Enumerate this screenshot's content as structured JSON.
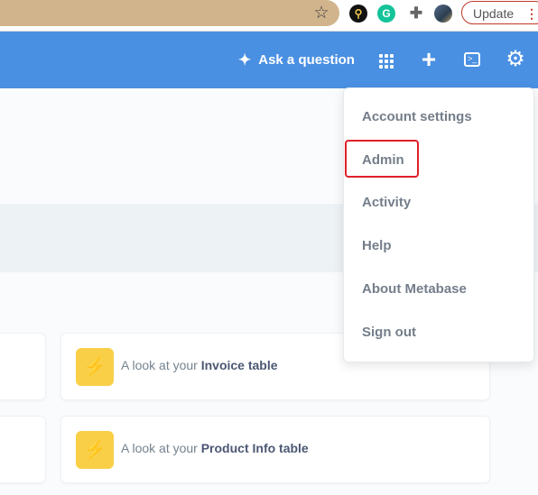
{
  "browser": {
    "update_label": "Update",
    "menu_dots": "⋮",
    "star_icon": "☆",
    "extensions": [
      "lens-extension-icon",
      "grammarly-icon",
      "puzzle-icon",
      "profile-avatar"
    ]
  },
  "topnav": {
    "ask_label": "Ask a question",
    "icons": [
      "sparkle-icon",
      "apps-grid-icon",
      "plus-icon",
      "sql-editor-icon",
      "gear-icon"
    ]
  },
  "menu": {
    "items": [
      {
        "label": "Account settings"
      },
      {
        "label": "Admin"
      },
      {
        "label": "Activity"
      },
      {
        "label": "Help"
      },
      {
        "label": "About Metabase"
      },
      {
        "label": "Sign out"
      }
    ],
    "highlighted": "Admin"
  },
  "cards": [
    {
      "prefix": "A look at your",
      "table": "Invoice table"
    },
    {
      "prefix": "A look at your",
      "table": "Product Info table"
    }
  ],
  "colors": {
    "nav": "#4a90e2",
    "bolt": "#f9cf48",
    "highlight": "#e0202a",
    "omnibox": "#d2b48c"
  }
}
